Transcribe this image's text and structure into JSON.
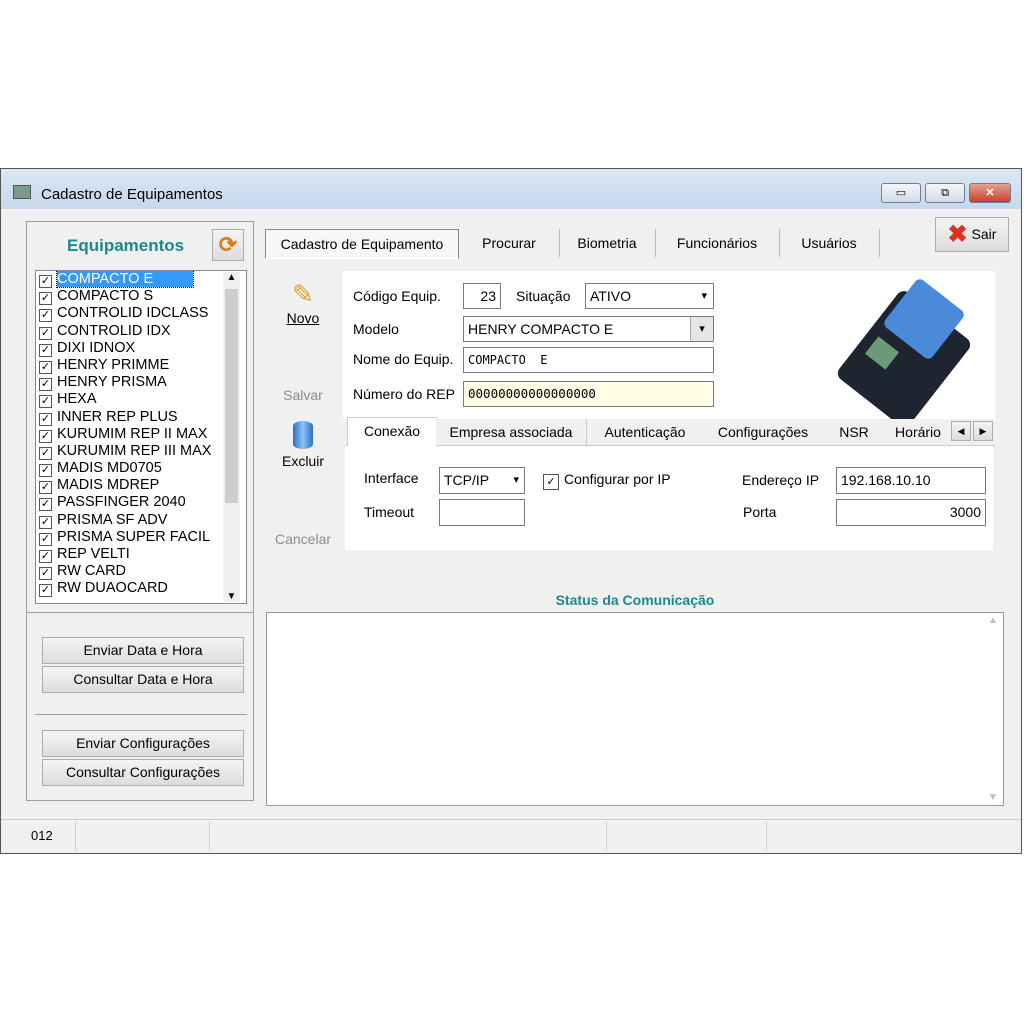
{
  "window": {
    "title": "Cadastro de Equipamentos",
    "minimize": "▭",
    "maximize": "⧉",
    "close": "✕"
  },
  "left": {
    "title": "Equipamentos",
    "refresh_icon": "refresh-icon",
    "items": [
      "COMPACTO E",
      "COMPACTO S",
      "CONTROLID IDCLASS",
      "CONTROLID IDX",
      "DIXI IDNOX",
      "HENRY PRIMME",
      "HENRY PRISMA",
      "HEXA",
      "INNER REP PLUS",
      "KURUMIM REP II MAX",
      "KURUMIM REP III MAX",
      "MADIS MD0705",
      "MADIS MDREP",
      "PASSFINGER 2040",
      "PRISMA SF ADV",
      "PRISMA SUPER FACIL",
      "REP VELTI",
      "RW CARD",
      "RW DUAOCARD"
    ],
    "selected": "COMPACTO E",
    "buttons": [
      "Enviar Data e Hora",
      "Consultar Data e Hora",
      "Enviar Configurações",
      "Consultar Configurações"
    ]
  },
  "tabs": [
    "Cadastro de Equipamento",
    "Procurar",
    "Biometria",
    "Funcionários",
    "Usuários"
  ],
  "active_tab": "Cadastro de Equipamento",
  "sair": "Sair",
  "actions": {
    "novo": "Novo",
    "salvar": "Salvar",
    "excluir": "Excluir",
    "cancelar": "Cancelar"
  },
  "form": {
    "codigo_label": "Código Equip.",
    "codigo": "23",
    "situacao_label": "Situação",
    "situacao": "ATIVO",
    "modelo_label": "Modelo",
    "modelo": "HENRY COMPACTO E",
    "nome_label": "Nome do Equip.",
    "nome": "COMPACTO  E",
    "rep_label": "Número do REP",
    "rep": "00000000000000000"
  },
  "inner_tabs": [
    "Conexão",
    "Empresa associada",
    "Autenticação",
    "Configurações",
    "NSR",
    "Horário"
  ],
  "conexao": {
    "interface_label": "Interface",
    "interface": "TCP/IP",
    "configurar_label": "Configurar por IP",
    "configurar_checked": true,
    "timeout_label": "Timeout",
    "timeout": "",
    "ip_label": "Endereço IP",
    "ip": "192.168.10.10",
    "porta_label": "Porta",
    "porta": "3000"
  },
  "status": {
    "title": "Status da Comunicação",
    "text": ""
  },
  "statusbar": [
    "012",
    "",
    "",
    "",
    ""
  ],
  "colors": {
    "accent": "#1a8a8a",
    "selection": "#3399ff",
    "rep_field": "#fffde6"
  }
}
